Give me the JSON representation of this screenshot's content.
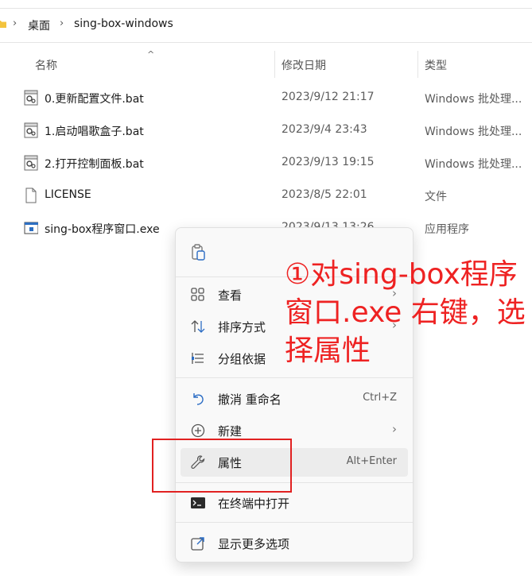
{
  "breadcrumb": {
    "items": [
      "桌面",
      "sing-box-windows"
    ]
  },
  "columns": {
    "name": "名称",
    "date": "修改日期",
    "type": "类型"
  },
  "files": [
    {
      "name": "0.更新配置文件.bat",
      "date": "2023/9/12 21:17",
      "type": "Windows 批处理...",
      "icon": "batch-file-icon"
    },
    {
      "name": "1.启动唱歌盒子.bat",
      "date": "2023/9/4 23:43",
      "type": "Windows 批处理...",
      "icon": "batch-file-icon"
    },
    {
      "name": "2.打开控制面板.bat",
      "date": "2023/9/13 19:15",
      "type": "Windows 批处理...",
      "icon": "batch-file-icon"
    },
    {
      "name": "LICENSE",
      "date": "2023/8/5 22:01",
      "type": "文件",
      "icon": "document-file-icon"
    },
    {
      "name": "sing-box程序窗口.exe",
      "date": "2023/9/13 13:26",
      "type": "应用程序",
      "icon": "application-file-icon"
    }
  ],
  "context_menu": {
    "items": [
      {
        "label": "查看",
        "icon": "grid-view-icon",
        "submenu": true
      },
      {
        "label": "排序方式",
        "icon": "sort-icon",
        "submenu": true
      },
      {
        "label": "分组依据",
        "icon": "group-list-icon",
        "submenu": false
      },
      {
        "label": "撤消 重命名",
        "icon": "undo-icon",
        "shortcut": "Ctrl+Z"
      },
      {
        "label": "新建",
        "icon": "plus-circle-icon",
        "submenu": true
      },
      {
        "label": "属性",
        "icon": "wrench-icon",
        "shortcut": "Alt+Enter"
      },
      {
        "label": "在终端中打开",
        "icon": "terminal-icon"
      },
      {
        "label": "显示更多选项",
        "icon": "share-more-icon"
      }
    ]
  },
  "annotation": {
    "text": "①对sing-box程序窗口.exe 右键，选择属性"
  },
  "colors": {
    "annotation": "#ee2222",
    "highlight_box": "#e12121",
    "menu_background": "#f9f9f9",
    "hover_background": "#ececec"
  }
}
